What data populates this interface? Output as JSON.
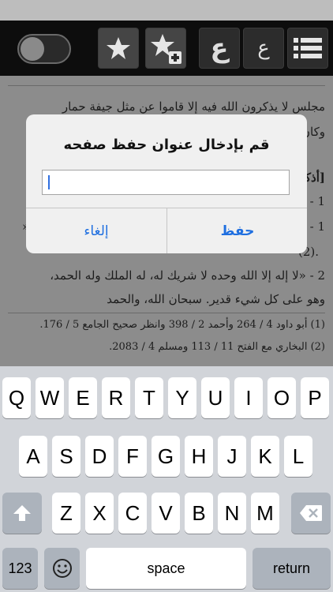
{
  "toolbar": {
    "toggle_state": "off",
    "buttons": [
      {
        "name": "bookmarks-button",
        "icon": "star-icon"
      },
      {
        "name": "add-bookmark-button",
        "icon": "star-plus-icon"
      },
      {
        "name": "font-larger-button",
        "label": "ع"
      },
      {
        "name": "font-smaller-button",
        "label": "ع"
      },
      {
        "name": "list-menu-button",
        "icon": "list-icon"
      }
    ]
  },
  "content": {
    "lines": [
      "مجلس لا يذكرون الله فيه إلا قاموا عن مثل جيفة حمار",
      "وكان لـ",
      "[أذكا",
      "1 - ",
      "1 - ",
      "(2).",
      "2 - «لا إله إلا الله وحده لا شريك له، له الملك وله الحمد،",
      "وهو على كل شيء قدير. سبحان الله، والحمد"
    ],
    "footnotes": [
      "(1) أبو داود 4 / 264 وأحمد 2 / 398 وانظر صحيح الجامع 5 / 176.",
      "(2) البخاري مع الفتح 11 / 113 ومسلم 4 / 2083."
    ],
    "quote_mark": "»"
  },
  "dialog": {
    "title": "قم بإدخال عنوان حفظ صفحه",
    "input_value": "",
    "cancel_label": "إلغاء",
    "save_label": "حفظ"
  },
  "keyboard": {
    "row1": [
      "Q",
      "W",
      "E",
      "R",
      "T",
      "Y",
      "U",
      "I",
      "O",
      "P"
    ],
    "row2": [
      "A",
      "S",
      "D",
      "F",
      "G",
      "H",
      "J",
      "K",
      "L"
    ],
    "row3": [
      "Z",
      "X",
      "C",
      "V",
      "B",
      "N",
      "M"
    ],
    "numbers_label": "123",
    "space_label": "space",
    "return_label": "return"
  }
}
